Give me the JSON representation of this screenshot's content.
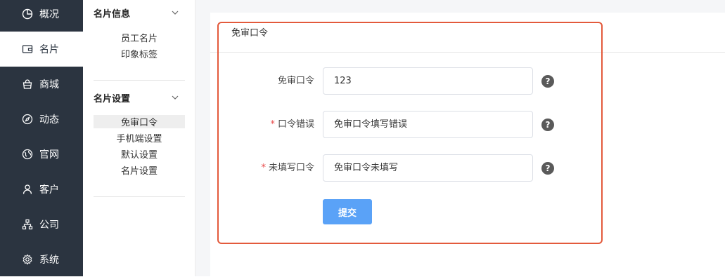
{
  "nav": {
    "items": [
      {
        "label": "概况",
        "icon": "pie-chart-icon"
      },
      {
        "label": "名片",
        "icon": "wallet-icon"
      },
      {
        "label": "商城",
        "icon": "shopping-bag-icon"
      },
      {
        "label": "动态",
        "icon": "compass-icon"
      },
      {
        "label": "官网",
        "icon": "globe-icon"
      },
      {
        "label": "客户",
        "icon": "user-icon"
      },
      {
        "label": "公司",
        "icon": "org-chart-icon"
      },
      {
        "label": "系统",
        "icon": "gear-icon"
      }
    ],
    "active_index": 1
  },
  "submenu": {
    "groups": [
      {
        "title": "名片信息",
        "items": [
          "员工名片",
          "印象标签"
        ]
      },
      {
        "title": "名片设置",
        "items": [
          "免审口令",
          "手机端设置",
          "默认设置",
          "名片设置"
        ],
        "active_item": "免审口令"
      }
    ]
  },
  "panel": {
    "title": "免审口令",
    "fields": [
      {
        "label": "免审口令",
        "required": false,
        "value": "123"
      },
      {
        "label": "口令错误",
        "required": true,
        "value": "免审口令填写错误"
      },
      {
        "label": "未填写口令",
        "required": true,
        "value": "免审口令未填写"
      }
    ],
    "required_mark": "*",
    "help_glyph": "?",
    "submit_label": "提交"
  },
  "colors": {
    "nav_bg": "#2b3440",
    "accent_button": "#5aa2f7",
    "highlight_border": "#e35a3c",
    "required": "#e94b4b"
  }
}
